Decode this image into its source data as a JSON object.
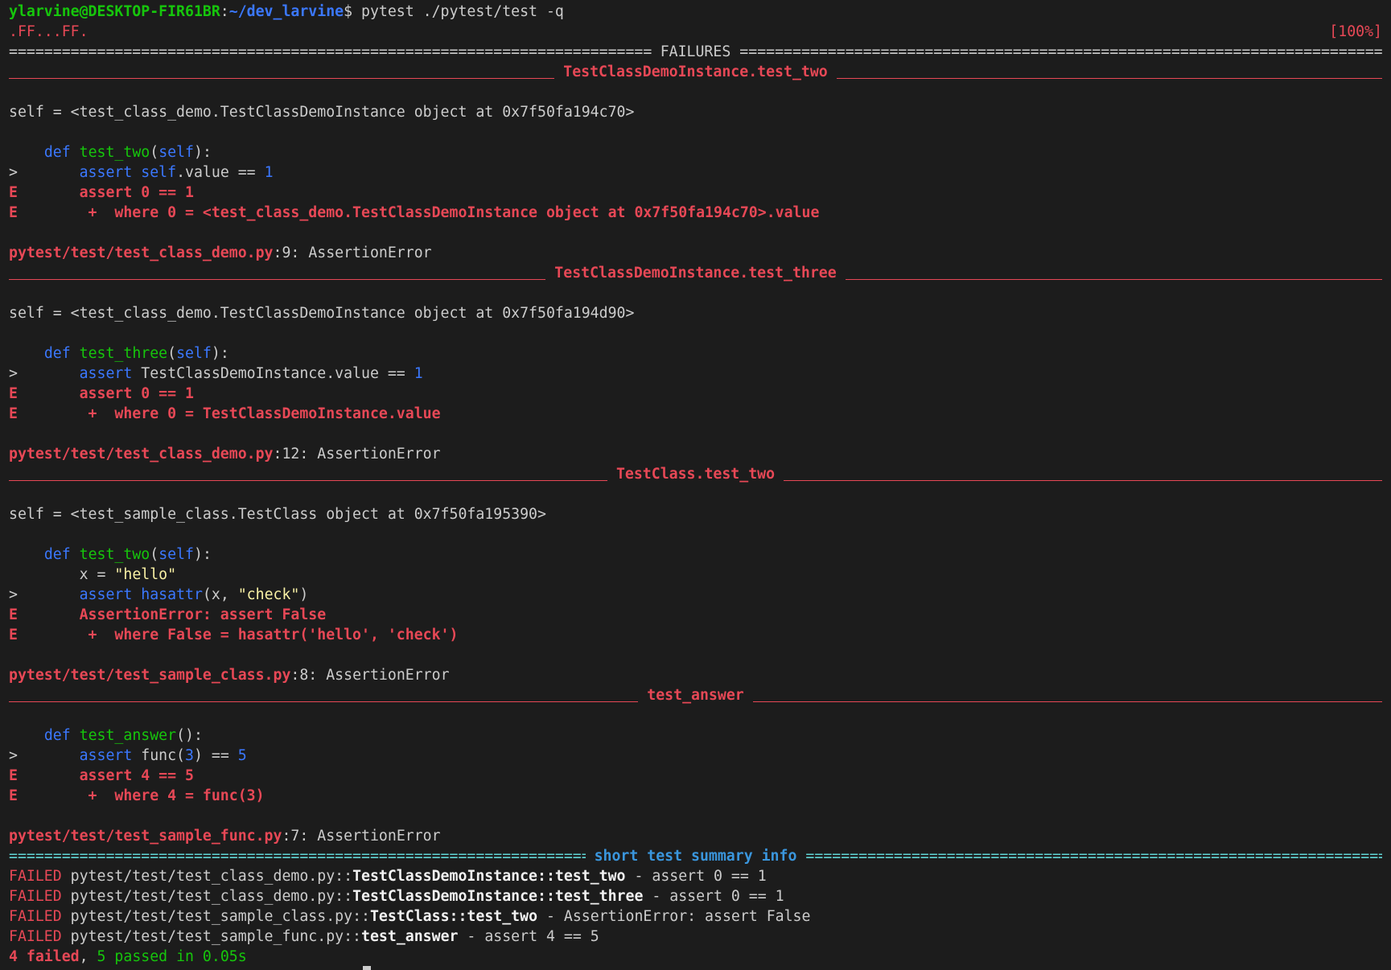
{
  "prompt": {
    "user_host": "ylarvine@DESKTOP-FIR61BR",
    "colon": ":",
    "path": "~/dev_larvine",
    "symbol": "$",
    "command": " pytest ./pytest/test -q"
  },
  "progress": {
    "dots": ".FF...FF.",
    "percent": "[100%]"
  },
  "failures_header": "FAILURES",
  "failures": [
    {
      "title": "TestClassDemoInstance.test_two",
      "self_line": "self = <test_class_demo.TestClassDemoInstance object at 0x7f50fa194c70>",
      "def_kw": "def",
      "def_name": "test_two",
      "def_open": "(",
      "def_arg": "self",
      "def_close": "):",
      "src_prefix": ">",
      "src_kw": "assert",
      "src_rest_a": "self",
      "src_rest_b": ".value == ",
      "src_num": "1",
      "err1": "assert 0 == 1",
      "err2": " +  where 0 = <test_class_demo.TestClassDemoInstance object at 0x7f50fa194c70>.value",
      "loc_file": "pytest/test/test_class_demo.py",
      "loc_line": ":9: ",
      "loc_err": "AssertionError"
    },
    {
      "title": "TestClassDemoInstance.test_three",
      "self_line": "self = <test_class_demo.TestClassDemoInstance object at 0x7f50fa194d90>",
      "def_kw": "def",
      "def_name": "test_three",
      "def_open": "(",
      "def_arg": "self",
      "def_close": "):",
      "src_prefix": ">",
      "src_kw": "assert",
      "src_rest": "TestClassDemoInstance.value == ",
      "src_num": "1",
      "err1": "assert 0 == 1",
      "err2": " +  where 0 = TestClassDemoInstance.value",
      "loc_file": "pytest/test/test_class_demo.py",
      "loc_line": ":12: ",
      "loc_err": "AssertionError"
    },
    {
      "title": "TestClass.test_two",
      "self_line": "self = <test_sample_class.TestClass object at 0x7f50fa195390>",
      "def_kw": "def",
      "def_name": "test_two",
      "def_open": "(",
      "def_arg": "self",
      "def_close": "):",
      "assign_a": "x = ",
      "assign_str": "\"hello\"",
      "src_prefix": ">",
      "src_kw": "assert",
      "src_fn": "hasattr",
      "src_args_a": "(x, ",
      "src_str": "\"check\"",
      "src_args_b": ")",
      "err1": "AssertionError: assert False",
      "err2": " +  where False = hasattr('hello', 'check')",
      "loc_file": "pytest/test/test_sample_class.py",
      "loc_line": ":8: ",
      "loc_err": "AssertionError"
    },
    {
      "title": "test_answer",
      "def_kw": "def",
      "def_name": "test_answer",
      "def_close": "():",
      "src_prefix": ">",
      "src_kw": "assert",
      "src_rest_a": " func(",
      "src_arg": "3",
      "src_rest_b": ") == ",
      "src_num": "5",
      "err1": "assert 4 == 5",
      "err2": " +  where 4 = func(3)",
      "loc_file": "pytest/test/test_sample_func.py",
      "loc_line": ":7: ",
      "loc_err": "AssertionError"
    }
  ],
  "err_marker": "E",
  "summary_header": "short test summary info",
  "summary": [
    {
      "status": "FAILED",
      "file": "pytest/test/test_class_demo.py",
      "sep": "::",
      "node": "TestClassDemoInstance::test_two",
      "msg": " - assert 0 == 1"
    },
    {
      "status": "FAILED",
      "file": "pytest/test/test_class_demo.py",
      "sep": "::",
      "node": "TestClassDemoInstance::test_three",
      "msg": " - assert 0 == 1"
    },
    {
      "status": "FAILED",
      "file": "pytest/test/test_sample_class.py",
      "sep": "::",
      "node": "TestClass::test_two",
      "msg": " - AssertionError: assert False"
    },
    {
      "status": "FAILED",
      "file": "pytest/test/test_sample_func.py",
      "sep": "::",
      "node": "test_answer",
      "msg": " - assert 4 == 5"
    }
  ],
  "result": {
    "failed": "4 failed",
    "comma": ", ",
    "passed": "5 passed in 0.05s"
  },
  "colors": {
    "background": "#1c1c1c",
    "failure_red": "#e74856",
    "prompt_green": "#16c60c",
    "prompt_blue": "#3b78ff",
    "summary_cyan": "#3a96dd"
  }
}
